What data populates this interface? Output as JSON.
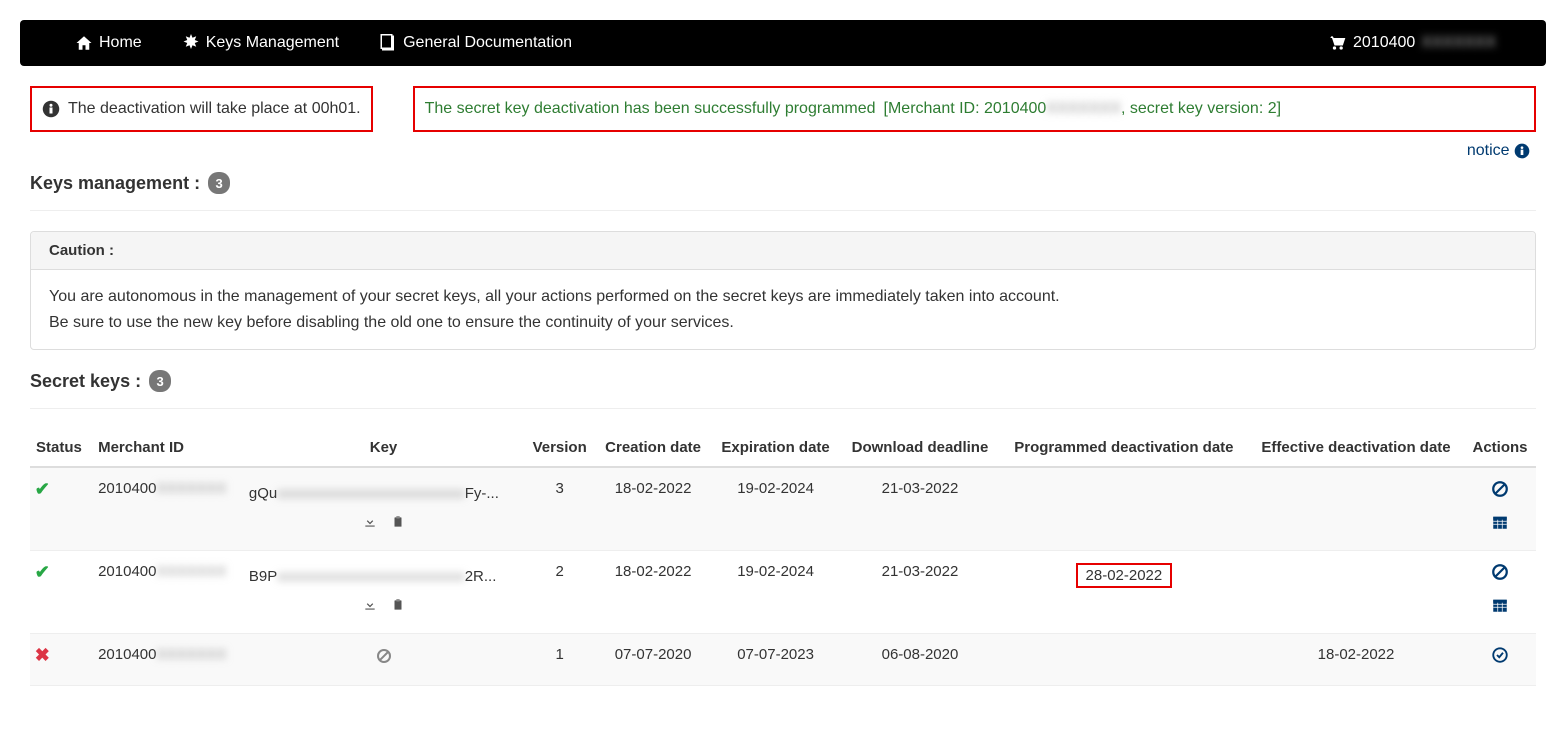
{
  "nav": {
    "home": "Home",
    "keys": "Keys Management",
    "docs": "General Documentation",
    "merchant": "2010400",
    "merchant_blur": "XXXXXXX"
  },
  "alerts": {
    "info": "The deactivation will take place at 00h01.",
    "success_main": "The secret key deactivation has been successfully programmed",
    "success_bracket_prefix": "[Merchant ID: 2010400",
    "success_bracket_blur": "XXXXXXX",
    "success_bracket_suffix": ", secret key version: 2]"
  },
  "notice": "notice",
  "sections": {
    "keys_mgmt_label": "Keys management :",
    "keys_mgmt_count": "3",
    "secret_keys_label": "Secret keys :",
    "secret_keys_count": "3"
  },
  "caution": {
    "header": "Caution :",
    "line1": "You are autonomous in the management of your secret keys, all your actions performed on the secret keys are immediately taken into account.",
    "line2": "Be sure to use the new key before disabling the old one to ensure the continuity of your services."
  },
  "table": {
    "headers": {
      "status": "Status",
      "merchant": "Merchant ID",
      "key": "Key",
      "version": "Version",
      "creation": "Creation date",
      "expiration": "Expiration date",
      "download": "Download deadline",
      "programmed": "Programmed deactivation date",
      "effective": "Effective deactivation date",
      "actions": "Actions"
    },
    "rows": [
      {
        "status": "ok",
        "merchant_prefix": "2010400",
        "key_prefix": "gQu",
        "key_blur": "xxxxxxxxxxxxxxxxxxxxxxxxx",
        "key_suffix": "Fy-...",
        "has_key_icons": true,
        "version": "3",
        "creation": "18-02-2022",
        "expiration": "19-02-2024",
        "download": "21-03-2022",
        "programmed": "",
        "effective": "",
        "actions": [
          "deactivate",
          "schedule"
        ]
      },
      {
        "status": "ok",
        "merchant_prefix": "2010400",
        "key_prefix": "B9P",
        "key_blur": "xxxxxxxxxxxxxxxxxxxxxxxxx",
        "key_suffix": "2R...",
        "has_key_icons": true,
        "version": "2",
        "creation": "18-02-2022",
        "expiration": "19-02-2024",
        "download": "21-03-2022",
        "programmed": "28-02-2022",
        "programmed_highlight": true,
        "effective": "",
        "actions": [
          "deactivate",
          "schedule"
        ]
      },
      {
        "status": "fail",
        "merchant_prefix": "2010400",
        "key_prefix": "",
        "key_disabled": true,
        "has_key_icons": false,
        "version": "1",
        "creation": "07-07-2020",
        "expiration": "07-07-2023",
        "download": "06-08-2020",
        "programmed": "",
        "effective": "18-02-2022",
        "actions": [
          "info"
        ]
      }
    ]
  }
}
